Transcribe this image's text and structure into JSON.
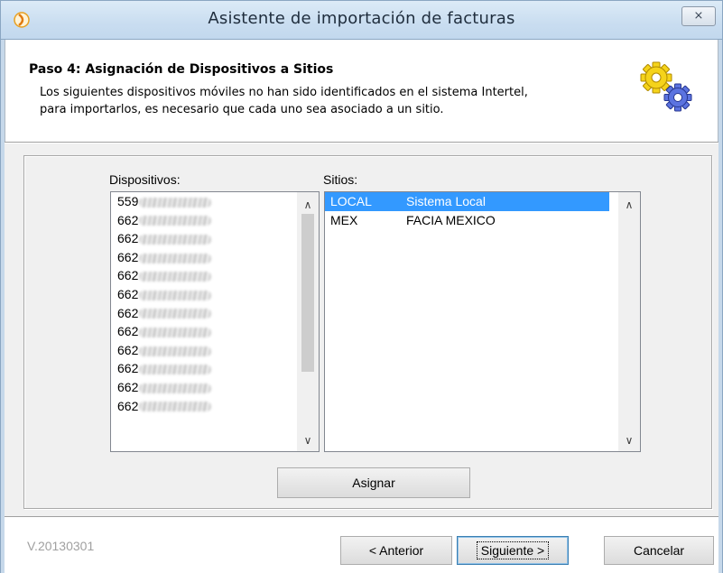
{
  "window": {
    "title": "Asistente de importación de facturas",
    "close_label": "⨯"
  },
  "header": {
    "step_title": "Paso 4: Asignación de Dispositivos a Sitios",
    "description_line1": "Los siguientes dispositivos móviles no han sido identificados en el sistema Intertel,",
    "description_line2": "para importarlos, es necesario que cada uno sea asociado a un sitio."
  },
  "labels": {
    "devices": "Dispositivos:",
    "sites": "Sitios:"
  },
  "devices": [
    {
      "prefix": "559"
    },
    {
      "prefix": "662"
    },
    {
      "prefix": "662"
    },
    {
      "prefix": "662"
    },
    {
      "prefix": "662"
    },
    {
      "prefix": "662"
    },
    {
      "prefix": "662"
    },
    {
      "prefix": "662"
    },
    {
      "prefix": "662"
    },
    {
      "prefix": "662"
    },
    {
      "prefix": "662"
    },
    {
      "prefix": "662"
    }
  ],
  "sites": [
    {
      "code": "LOCAL",
      "name": "Sistema Local",
      "selected": true
    },
    {
      "code": "MEX",
      "name": "FACIA MEXICO",
      "selected": false
    }
  ],
  "buttons": {
    "assign": "Asignar",
    "previous": "< Anterior",
    "next": "Siguiente >",
    "cancel": "Cancelar"
  },
  "footer": {
    "version": "V.20130301"
  },
  "colors": {
    "selection": "#3399ff",
    "title_bar": "#c9ddf0"
  },
  "icons": {
    "app": "app-logo-icon",
    "header": "gears-icon"
  }
}
